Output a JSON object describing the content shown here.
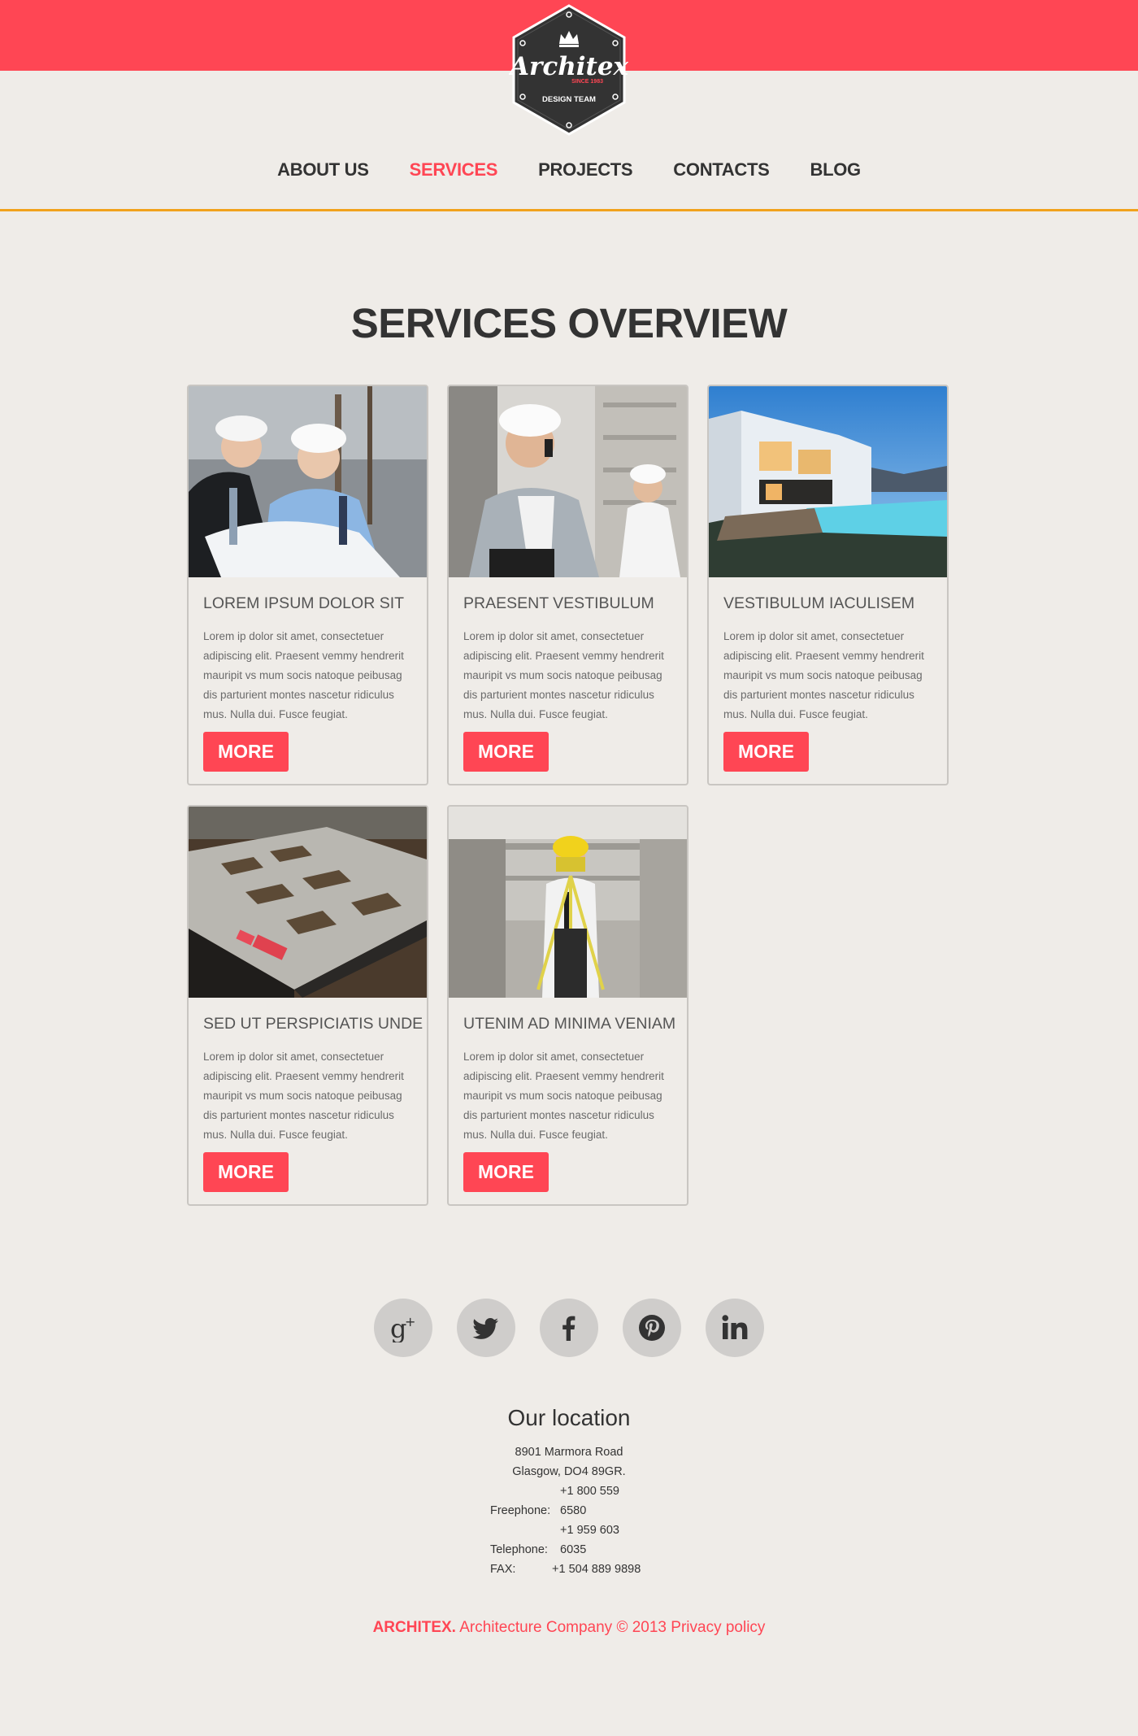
{
  "header": {
    "logo": {
      "name": "Architex",
      "since": "SINCE 1983",
      "tagline": "DESIGN TEAM"
    },
    "nav": [
      {
        "label": "ABOUT US",
        "active": false
      },
      {
        "label": "SERVICES",
        "active": true
      },
      {
        "label": "PROJECTS",
        "active": false
      },
      {
        "label": "CONTACTS",
        "active": false
      },
      {
        "label": "BLOG",
        "active": false
      }
    ]
  },
  "main": {
    "title": "SERVICES OVERVIEW",
    "cards": [
      {
        "image": "engineers-with-blueprints-photo",
        "title": "LOREM IPSUM DOLOR SIT",
        "text": "Lorem ip dolor sit amet, consectetuer adipiscing elit. Praesent vemmy hendrerit mauripit vs mum socis natoque peibusag dis parturient montes nascetur ridiculus mus. Nulla dui. Fusce feugiat.",
        "button": "MORE"
      },
      {
        "image": "engineer-on-phone-photo",
        "title": "PRAESENT VESTIBULUM",
        "text": "Lorem ip dolor sit amet, consectetuer adipiscing elit. Praesent vemmy hendrerit mauripit vs mum socis natoque peibusag dis parturient montes nascetur ridiculus mus. Nulla dui. Fusce feugiat.",
        "button": "MORE"
      },
      {
        "image": "modern-villa-pool-photo",
        "title": "VESTIBULUM IACULISEM",
        "text": "Lorem ip dolor sit amet, consectetuer adipiscing elit. Praesent vemmy hendrerit mauripit vs mum socis natoque peibusag dis parturient montes nascetur ridiculus mus. Nulla dui. Fusce feugiat.",
        "button": "MORE"
      },
      {
        "image": "construction-foundation-photo",
        "title": "SED UT PERSPICIATIS UNDE",
        "text": "Lorem ip dolor sit amet, consectetuer adipiscing elit. Praesent vemmy hendrerit mauripit vs mum socis natoque peibusag dis parturient montes nascetur ridiculus mus. Nulla dui. Fusce feugiat.",
        "button": "MORE"
      },
      {
        "image": "surveyor-with-tripod-photo",
        "title": "UTENIM AD MINIMA VENIAM",
        "text": "Lorem ip dolor sit amet, consectetuer adipiscing elit. Praesent vemmy hendrerit mauripit vs mum socis natoque peibusag dis parturient montes nascetur ridiculus mus. Nulla dui. Fusce feugiat.",
        "button": "MORE"
      }
    ]
  },
  "social": [
    {
      "icon": "google-plus-icon"
    },
    {
      "icon": "twitter-icon"
    },
    {
      "icon": "facebook-icon"
    },
    {
      "icon": "pinterest-icon"
    },
    {
      "icon": "linkedin-icon"
    }
  ],
  "location": {
    "title": "Our location",
    "street": "8901 Marmora Road",
    "city": "Glasgow, DO4 89GR.",
    "rows": [
      {
        "label": "Freephone:",
        "value": "+1 800 559 6580"
      },
      {
        "label": "Telephone:",
        "value": "+1 959 603 6035"
      },
      {
        "label": "FAX:",
        "value": "+1 504 889 9898"
      }
    ]
  },
  "footer": {
    "brand": "ARCHITEX.",
    "text": "Architecture Company © 2013",
    "link": "Privacy policy"
  },
  "colors": {
    "accent": "#ff4654",
    "nav_line": "#f1a21c",
    "background": "#efece8",
    "text": "#333333"
  }
}
